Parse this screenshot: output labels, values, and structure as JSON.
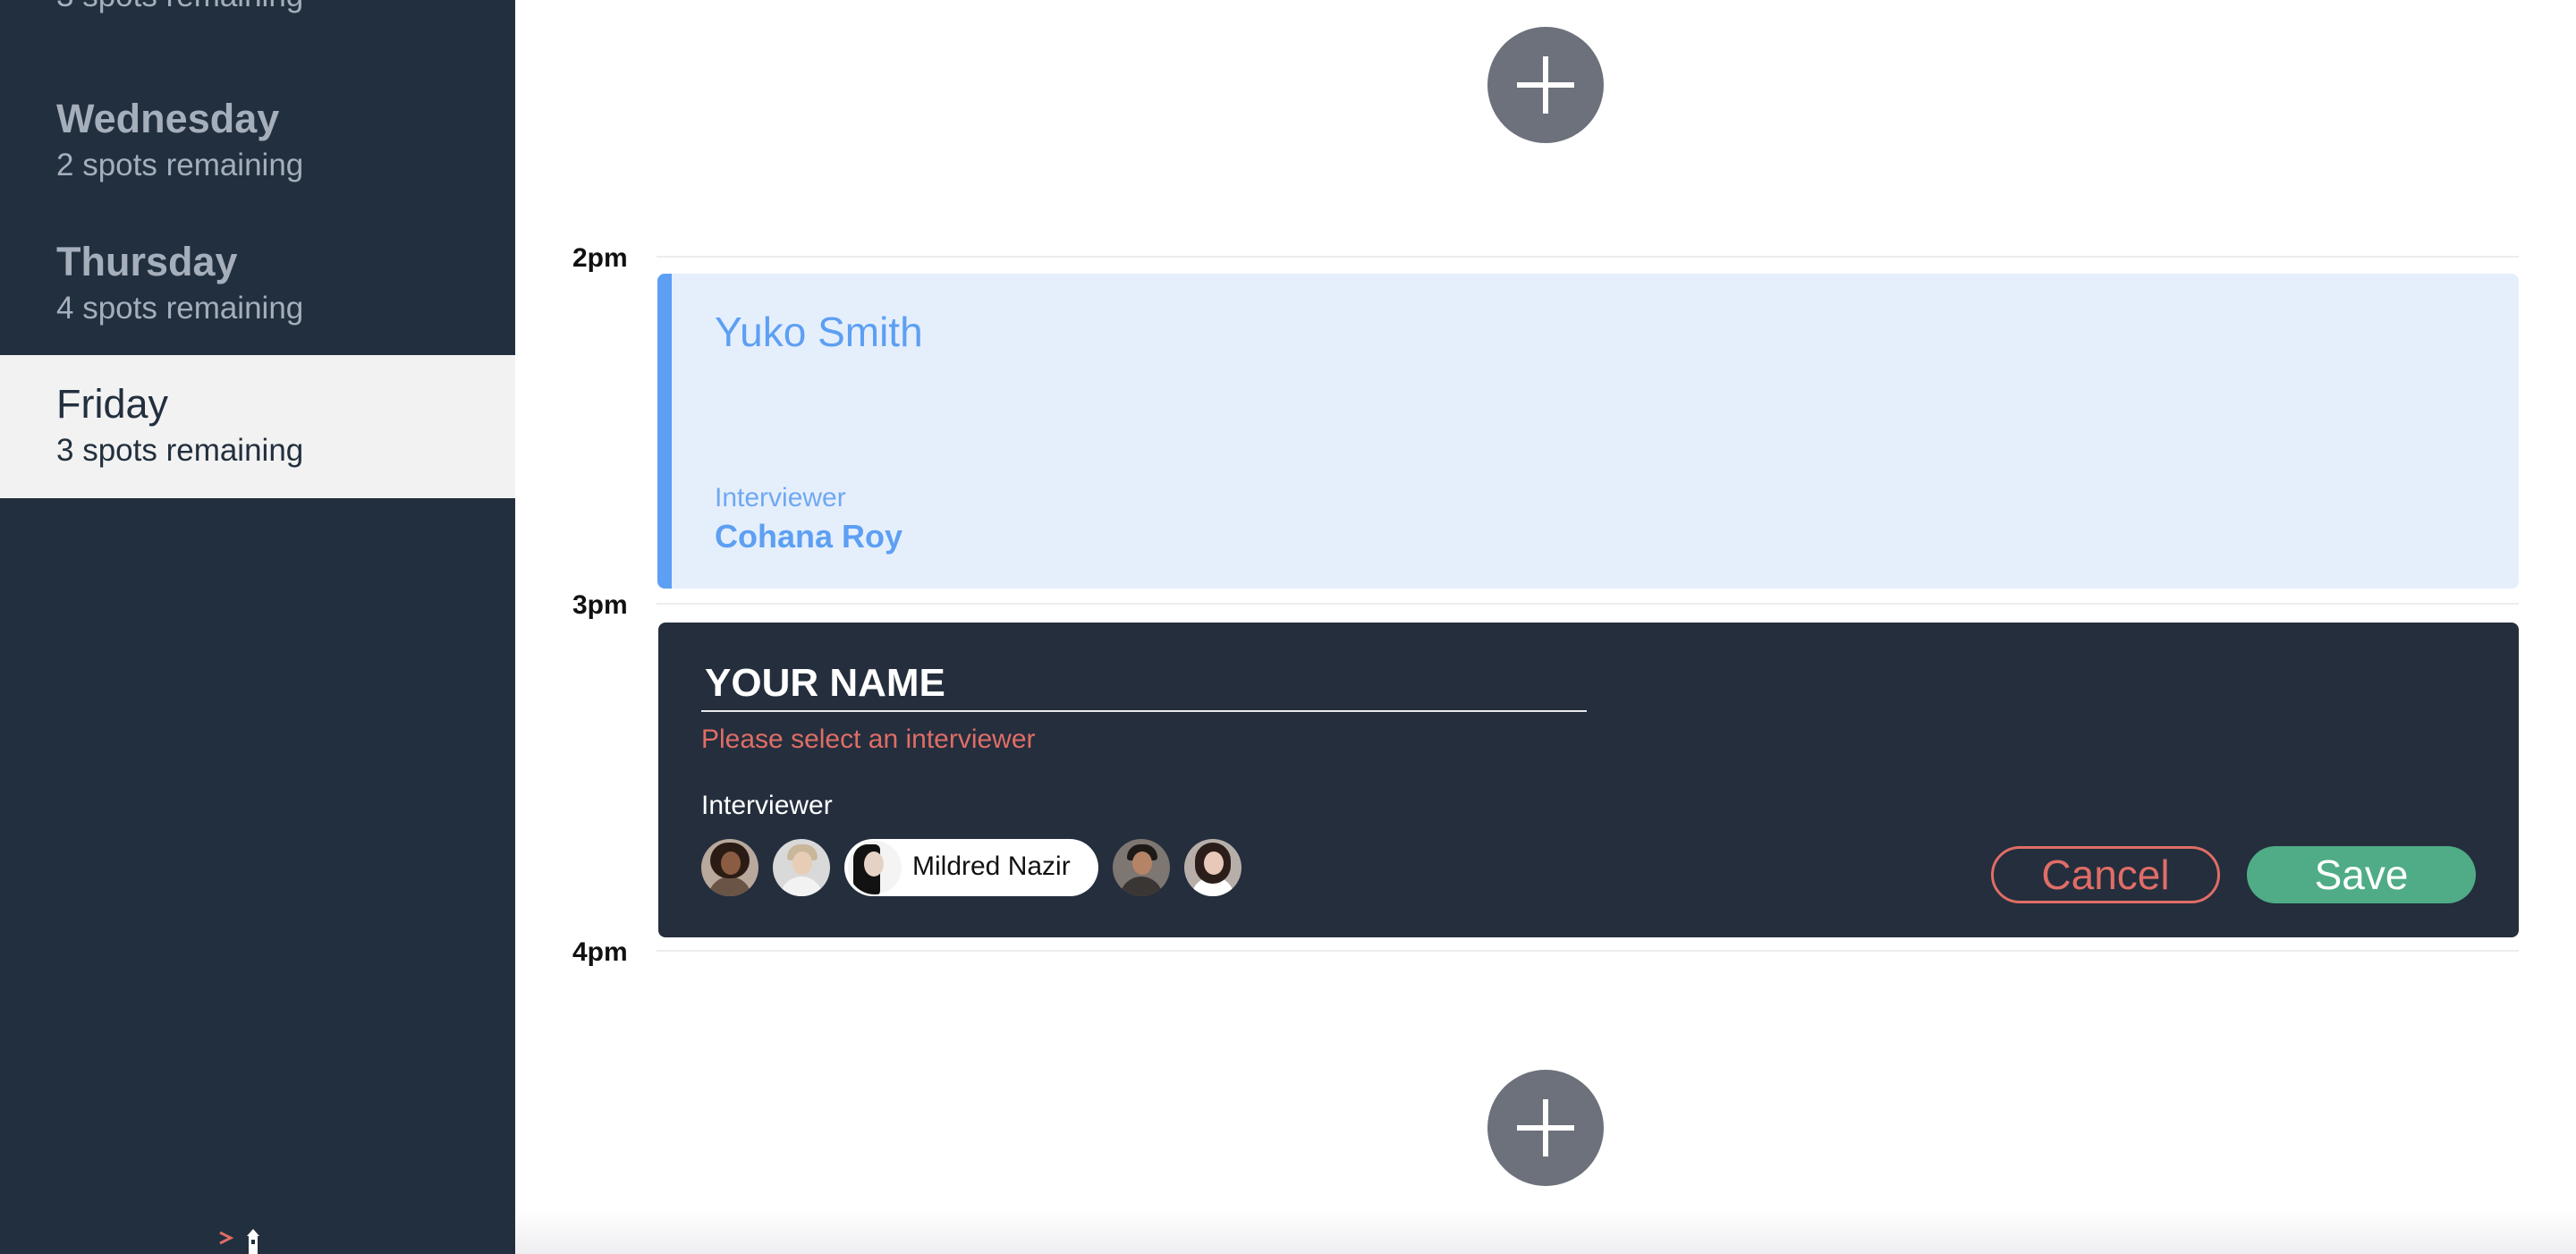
{
  "sidebar": {
    "days": [
      {
        "name": "",
        "spots": "3 spots remaining",
        "selected": false
      },
      {
        "name": "Wednesday",
        "spots": "2 spots remaining",
        "selected": false
      },
      {
        "name": "Thursday",
        "spots": "4 spots remaining",
        "selected": false
      },
      {
        "name": "Friday",
        "spots": "3 spots remaining",
        "selected": true
      }
    ],
    "logo_icon": "lighthouse-logo-icon"
  },
  "schedule": {
    "add_icon": "plus-icon",
    "times": [
      "2pm",
      "3pm",
      "4pm"
    ]
  },
  "appointment": {
    "student": "Yuko Smith",
    "interviewer_label": "Interviewer",
    "interviewer_name": "Cohana Roy"
  },
  "form": {
    "name_placeholder": "YOUR NAME",
    "name_value": "",
    "error": "Please select an interviewer",
    "interviewer_label": "Interviewer",
    "selected_interviewer": "Mildred Nazir",
    "cancel_label": "Cancel",
    "save_label": "Save"
  },
  "colors": {
    "sidebar_bg": "#222f3e",
    "appointment_accent": "#5d9ff3",
    "appointment_bg": "#e5effc",
    "form_bg": "#242e3d",
    "error": "#e06d66",
    "save": "#4fac86"
  }
}
